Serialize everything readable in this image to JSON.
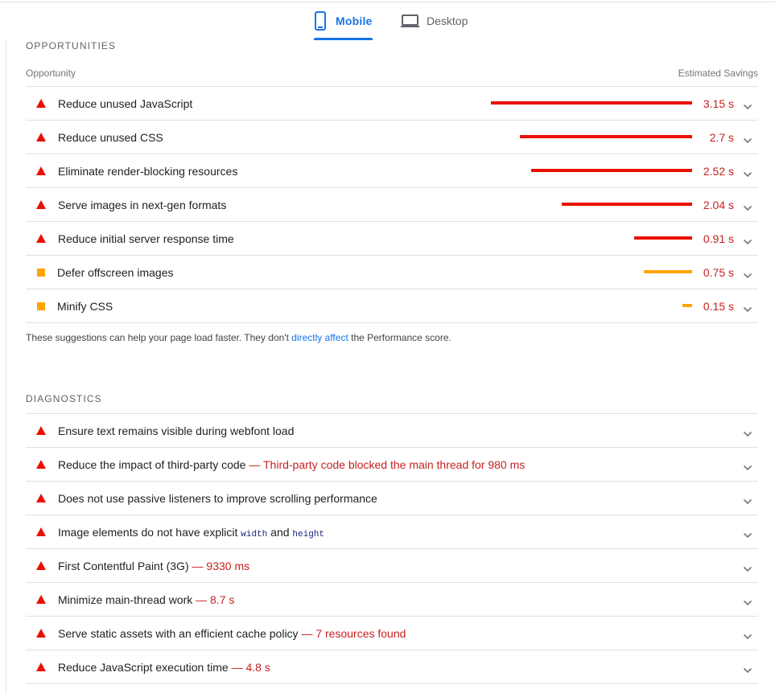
{
  "tabs": [
    {
      "label": "Mobile",
      "icon": "mobile-phone-icon",
      "active": true
    },
    {
      "label": "Desktop",
      "icon": "laptop-icon",
      "active": false
    }
  ],
  "colors": {
    "fail": "#eb0f00",
    "average": "#ffa400",
    "accent": "#1a73e8",
    "value": "#c5221f"
  },
  "opportunities": {
    "title": "OPPORTUNITIES",
    "col_left": "Opportunity",
    "col_right": "Estimated Savings",
    "max_savings_s": 3.15,
    "items": [
      {
        "title": "Reduce unused JavaScript",
        "savings": "3.15 s",
        "savings_s": 3.15,
        "severity": "fail"
      },
      {
        "title": "Reduce unused CSS",
        "savings": "2.7 s",
        "savings_s": 2.7,
        "severity": "fail"
      },
      {
        "title": "Eliminate render-blocking resources",
        "savings": "2.52 s",
        "savings_s": 2.52,
        "severity": "fail"
      },
      {
        "title": "Serve images in next-gen formats",
        "savings": "2.04 s",
        "savings_s": 2.04,
        "severity": "fail"
      },
      {
        "title": "Reduce initial server response time",
        "savings": "0.91 s",
        "savings_s": 0.91,
        "severity": "fail"
      },
      {
        "title": "Defer offscreen images",
        "savings": "0.75 s",
        "savings_s": 0.75,
        "severity": "average"
      },
      {
        "title": "Minify CSS",
        "savings": "0.15 s",
        "savings_s": 0.15,
        "severity": "average"
      }
    ],
    "note_before": "These suggestions can help your page load faster. They don't ",
    "note_link": "directly affect",
    "note_after": " the Performance score."
  },
  "diagnostics": {
    "title": "DIAGNOSTICS",
    "items": [
      {
        "title": "Ensure text remains visible during webfont load",
        "value": ""
      },
      {
        "title": "Reduce the impact of third-party code",
        "value": "— Third-party code blocked the main thread for 980 ms"
      },
      {
        "title": "Does not use passive listeners to improve scrolling performance",
        "value": ""
      },
      {
        "title": "Image elements do not have explicit",
        "code1": "width",
        "and": "and",
        "code2": "height",
        "value": ""
      },
      {
        "title": "First Contentful Paint (3G)",
        "value": "— 9330 ms"
      },
      {
        "title": "Minimize main-thread work",
        "value": "— 8.7 s"
      },
      {
        "title": "Serve static assets with an efficient cache policy",
        "value": "— 7 resources found"
      },
      {
        "title": "Reduce JavaScript execution time",
        "value": "— 4.8 s"
      }
    ]
  }
}
